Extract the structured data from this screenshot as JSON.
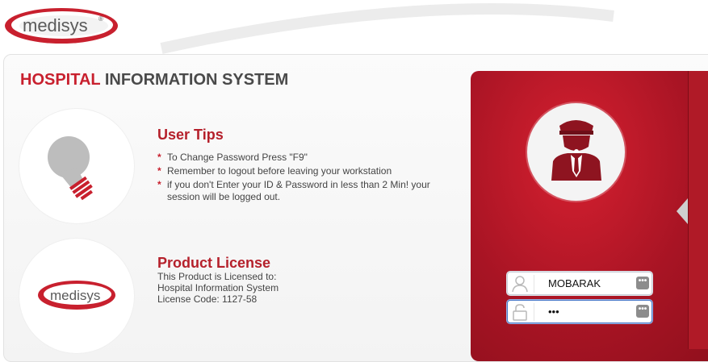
{
  "header": {
    "logo_text": "medisys"
  },
  "page": {
    "title_part1": "HOSPITAL",
    "title_part2": "INFORMATION SYSTEM"
  },
  "tips": {
    "heading": "User Tips",
    "items": [
      "To Change Password Press \"F9\"",
      "Remember to logout before leaving your workstation",
      "if you don't Enter your ID & Password in less than 2 Min! your session will be logged out."
    ]
  },
  "license": {
    "heading": "Product License",
    "lines": [
      "This Product is Licensed to:",
      "Hospital Information System",
      "License Code: 1127-58"
    ]
  },
  "login": {
    "username_value": "MOBARAK",
    "password_value": "•••",
    "keyboard_icon": "keyboard-dots-icon"
  },
  "colors": {
    "brand_red": "#c8202e",
    "panel_red": "#a81424",
    "title_grey": "#4a4a4a"
  }
}
